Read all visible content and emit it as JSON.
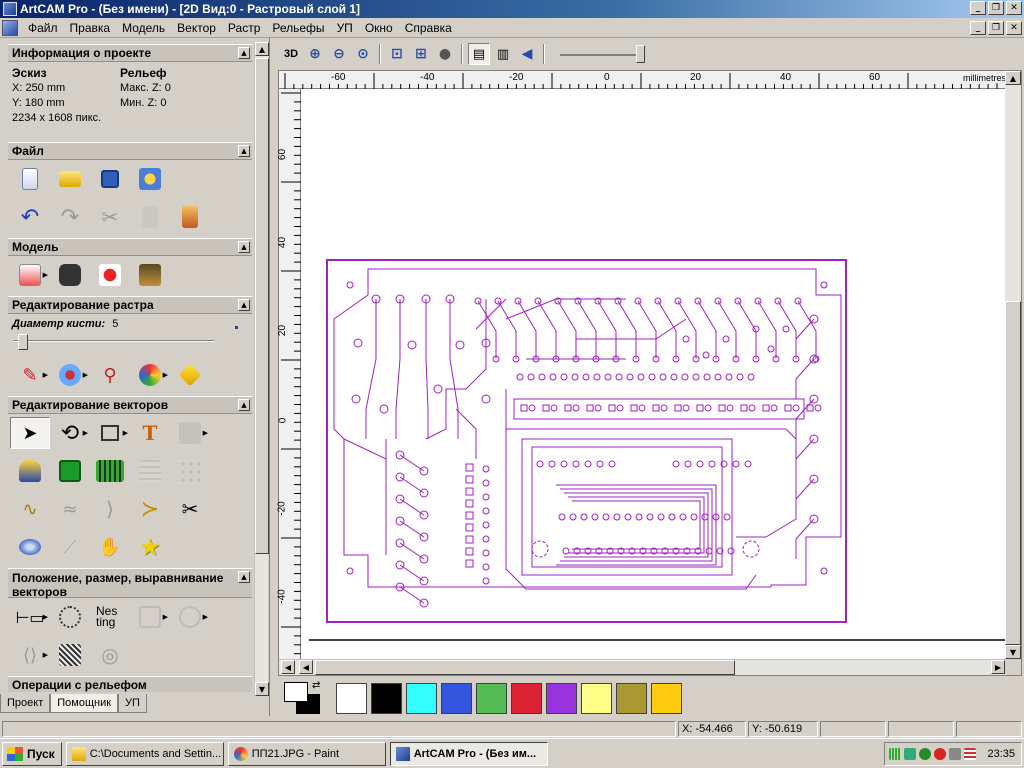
{
  "window": {
    "title": "ArtCAM Pro - (Без имени) - [2D Вид:0 - Растровый слой 1]"
  },
  "window_buttons": [
    "_",
    "❐",
    "✕"
  ],
  "menu": [
    "Файл",
    "Правка",
    "Модель",
    "Вектор",
    "Растр",
    "Рельефы",
    "УП",
    "Окно",
    "Справка"
  ],
  "panel": {
    "project_info": {
      "title": "Информация о проекте",
      "sketch_label": "Эскиз",
      "sketch_x": "X: 250 mm",
      "sketch_y": "Y: 180 mm",
      "sketch_px": "2234 x 1608 пикс.",
      "relief_label": "Рельеф",
      "relief_max": "Макс. Z: 0",
      "relief_min": "Мин. Z: 0"
    },
    "file": {
      "title": "Файл"
    },
    "model": {
      "title": "Модель"
    },
    "raster_edit": {
      "title": "Редактирование растра",
      "brush_label": "Диаметр кисти:",
      "brush_value": "5"
    },
    "vector_edit": {
      "title": "Редактирование векторов"
    },
    "position": {
      "title": "Положение, размер, выравнивание векторов",
      "nesting_label": "Nes ting"
    },
    "relief_ops": {
      "title": "Операции с рельефом"
    },
    "tabs": [
      "Проект",
      "Помощник",
      "УП"
    ],
    "active_tab": "Помощник"
  },
  "toolbar": {
    "view3d_label": "3D"
  },
  "ruler": {
    "units": "millimetres",
    "top_labels": [
      "-60",
      "-40",
      "-20",
      "0",
      "20",
      "40",
      "60"
    ],
    "left_labels": [
      "60",
      "40",
      "20",
      "0",
      "-20",
      "-40"
    ]
  },
  "palette": [
    "#ffffff",
    "#000000",
    "#33ffff",
    "#3355dd",
    "#55bb55",
    "#dd2233",
    "#9933dd",
    "#ffff88",
    "#aa9933",
    "#ffcc11"
  ],
  "pcb_color": "#a020c0",
  "status": {
    "x": "X: -54.466",
    "y": "Y: -50.619"
  },
  "taskbar": {
    "start": "Пуск",
    "tasks": [
      "C:\\Documents and Settin...",
      "ПП21.JPG - Paint",
      "ArtCAM Pro - (Без им..."
    ],
    "clock": "23:35"
  }
}
